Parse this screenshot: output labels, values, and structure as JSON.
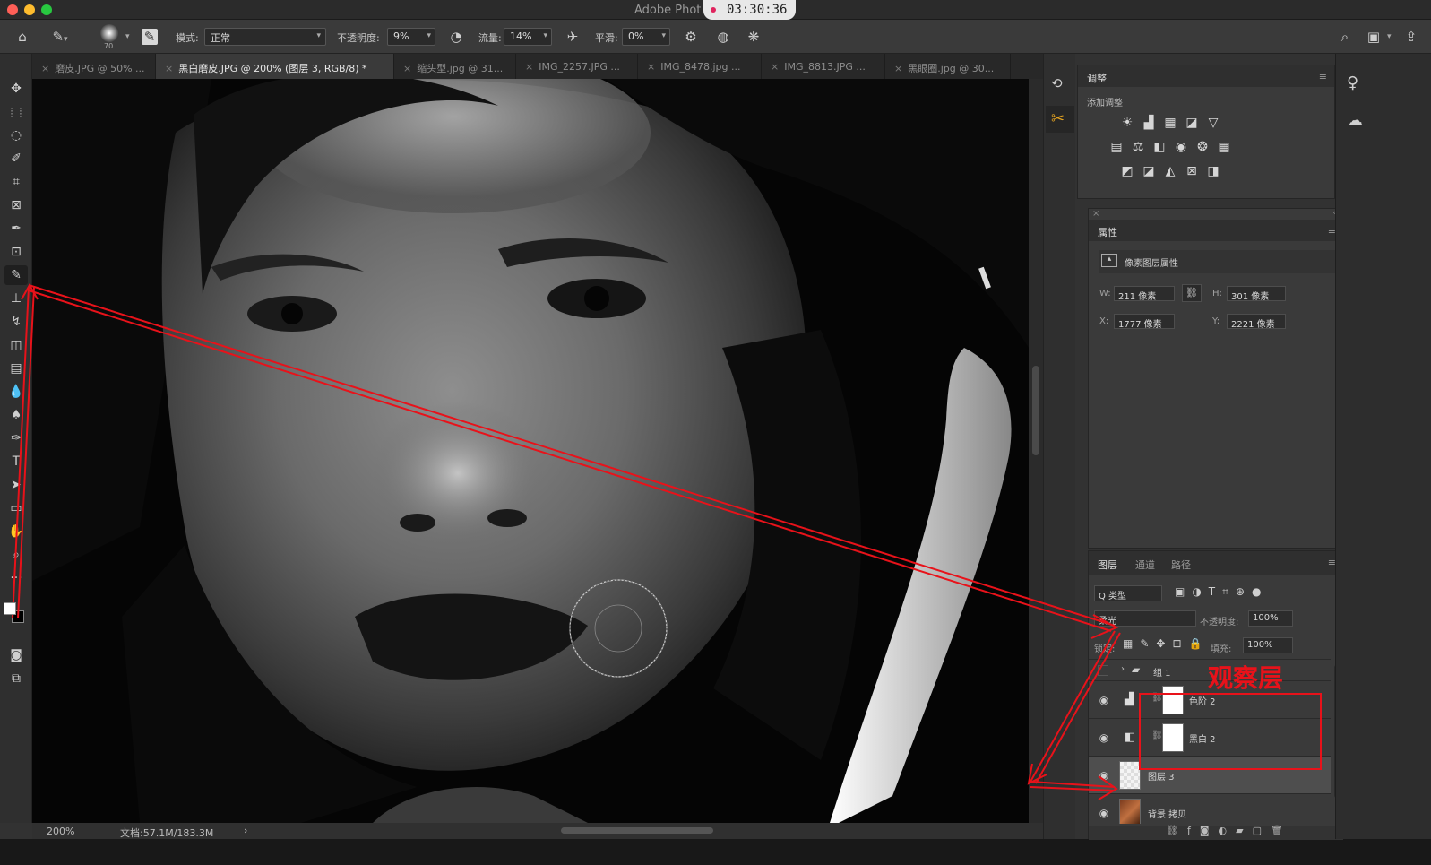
{
  "app": {
    "title": "Adobe Phot",
    "timer": "03:30:36"
  },
  "options_bar": {
    "brush_size": "70",
    "mode_label": "模式:",
    "mode_value": "正常",
    "opacity_label": "不透明度:",
    "opacity_value": "9%",
    "flow_label": "流量:",
    "flow_value": "14%",
    "smoothing_label": "平滑:",
    "smoothing_value": "0%"
  },
  "tabs": [
    {
      "label": "磨皮.JPG @ 50% ...",
      "active": false
    },
    {
      "label": "黑白磨皮.JPG @ 200% (图层 3, RGB/8) *",
      "active": true
    },
    {
      "label": "缩头型.jpg @ 31...",
      "active": false
    },
    {
      "label": "IMG_2257.JPG ...",
      "active": false
    },
    {
      "label": "IMG_8478.jpg ...",
      "active": false
    },
    {
      "label": "IMG_8813.JPG ...",
      "active": false
    },
    {
      "label": "黑眼圈.jpg @ 30...",
      "active": false
    }
  ],
  "status": {
    "zoom": "200%",
    "doc": "文档:57.1M/183.3M",
    "arrow": "›"
  },
  "adjustments": {
    "title": "调整",
    "subtitle": "添加调整"
  },
  "properties": {
    "title": "属性",
    "subtitle": "像素图层属性",
    "w_label": "W:",
    "w_value": "211 像素",
    "h_label": "H:",
    "h_value": "301 像素",
    "x_label": "X:",
    "x_value": "1777 像素",
    "y_label": "Y:",
    "y_value": "2221 像素"
  },
  "layers_panel": {
    "tabs": [
      "图层",
      "通道",
      "路径"
    ],
    "filter_kind": "Q 类型",
    "blend_mode": "柔光",
    "opacity_label": "不透明度:",
    "opacity_value": "100%",
    "lock_label": "锁定:",
    "fill_label": "填充:",
    "fill_value": "100%",
    "layers": [
      {
        "name": "组 1",
        "type": "group",
        "visible": false
      },
      {
        "name": "色阶 2",
        "type": "levels",
        "visible": true
      },
      {
        "name": "黑白 2",
        "type": "bw",
        "visible": true
      },
      {
        "name": "图层 3",
        "type": "pixel",
        "visible": true,
        "selected": true
      },
      {
        "name": "背景 拷贝",
        "type": "photo",
        "visible": true
      }
    ],
    "footer_icons": [
      "link-icon",
      "fx-icon",
      "mask-icon",
      "adjustment-icon",
      "folder-icon",
      "new-layer-icon",
      "trash-icon"
    ]
  },
  "annotation": {
    "label": "观察层",
    "color": "#e8121a"
  },
  "colors": {
    "foreground": "#ffffff",
    "background": "#000000"
  }
}
